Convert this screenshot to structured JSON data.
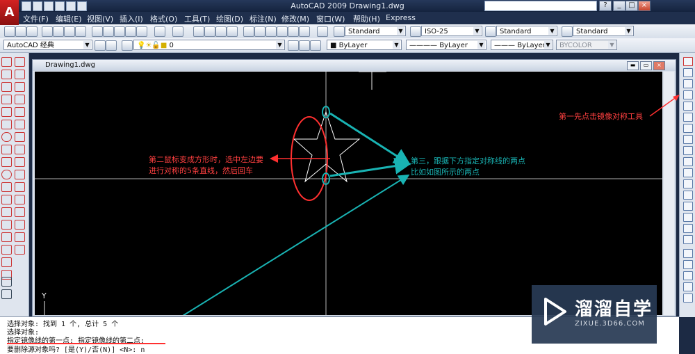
{
  "window": {
    "title": "AutoCAD 2009  Drawing1.dwg",
    "logo": "A"
  },
  "menus": [
    "文件(F)",
    "编辑(E)",
    "视图(V)",
    "插入(I)",
    "格式(O)",
    "工具(T)",
    "绘图(D)",
    "标注(N)",
    "修改(M)",
    "窗口(W)",
    "帮助(H)",
    "Express"
  ],
  "toolbar": {
    "text_style": "Standard",
    "dim_style": "ISO-25",
    "table_style": "Standard",
    "multileader_style": "Standard",
    "workspace": "AutoCAD 经典",
    "layer": "0",
    "color": "ByLayer",
    "linetype": "ByLayer",
    "lineweight": "ByLayer",
    "plot_style": "BYCOLOR"
  },
  "drawing": {
    "tab_title": "Drawing1.dwg",
    "ucs_y": "Y"
  },
  "annotations": {
    "step1": "第一先点击镜像对称工具",
    "step2_line1": "第二鼠标变成方形时，选中左边要",
    "step2_line2": "进行对称的5条直线，然后回车",
    "step3_line1": "第三，跟据下方指定对称线的两点",
    "step3_line2": "比如如图所示的两点"
  },
  "command": {
    "lines": [
      "选择对象: 找到 1 个, 总计 5 个",
      "选择对象:",
      "指定镜像线的第一点: 指定镜像线的第二点:",
      "要删除源对象吗? [是(Y)/否(N)] <N>: n"
    ]
  },
  "watermark": {
    "title": "溜溜自学",
    "subtitle": "ZIXUE.3D66.COM"
  },
  "colors": {
    "annotation_red": "#ff4040",
    "annotation_cyan": "#19b3b3",
    "canvas": "#000000"
  }
}
